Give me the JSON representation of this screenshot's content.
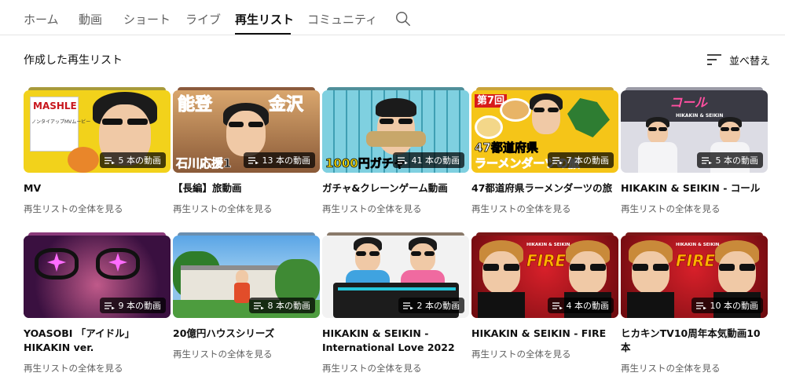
{
  "tabs": [
    {
      "label": "ホーム",
      "active": false
    },
    {
      "label": "動画",
      "active": false
    },
    {
      "label": "ショート",
      "active": false
    },
    {
      "label": "ライブ",
      "active": false
    },
    {
      "label": "再生リスト",
      "active": true
    },
    {
      "label": "コミュニティ",
      "active": false
    }
  ],
  "search": {
    "icon": "search-icon"
  },
  "section": {
    "title": "作成した再生リスト",
    "sort_label": "並べ替え",
    "sort_icon": "sort-icon"
  },
  "playlist_icon": "playlist-icon",
  "playlists": [
    {
      "title": "MV",
      "count": "5 本の動画",
      "link": "再生リストの全体を見る",
      "thumb_text": [
        "MASHLE",
        "ノンタイアップMVムービー"
      ]
    },
    {
      "title": "【長編】旅動画",
      "count": "13 本の動画",
      "link": "再生リストの全体を見る",
      "thumb_text": [
        "能登",
        "金沢",
        "石川応援1"
      ]
    },
    {
      "title": "ガチャ&クレーンゲーム動画",
      "count": "41 本の動画",
      "link": "再生リストの全体を見る",
      "thumb_text": [
        "1000円ガチャ"
      ]
    },
    {
      "title": "47都道府県ラーメンダーツの旅",
      "count": "7 本の動画",
      "link": "再生リストの全体を見る",
      "thumb_text": [
        "第7回",
        "47都道府県",
        "ラーメンダーツの旅"
      ]
    },
    {
      "title": "HIKAKIN & SEIKIN - コール",
      "count": "5 本の動画",
      "link": "再生リストの全体を見る",
      "thumb_text": [
        "コール",
        "HIKAKIN & SEIKIN"
      ]
    },
    {
      "title": "YOASOBI 「アイドル」 HIKAKIN ver.",
      "count": "9 本の動画",
      "link": "再生リストの全体を見る",
      "thumb_text": []
    },
    {
      "title": "20億円ハウスシリーズ",
      "count": "8 本の動画",
      "link": "再生リストの全体を見る",
      "thumb_text": []
    },
    {
      "title": "HIKAKIN & SEIKIN - International Love 2022",
      "count": "2 本の動画",
      "link": "再生リストの全体を見る",
      "thumb_text": []
    },
    {
      "title": "HIKAKIN & SEIKIN - FIRE",
      "count": "4 本の動画",
      "link": "再生リストの全体を見る",
      "thumb_text": [
        "HIKAKIN & SEIKIN",
        "FIRE"
      ]
    },
    {
      "title": "ヒカキンTV10周年本気動画10本",
      "count": "10 本の動画",
      "link": "再生リストの全体を見る",
      "thumb_text": [
        "HIKAKIN & SEIKIN",
        "FIRE"
      ]
    }
  ],
  "colors": {
    "text_primary": "#0f0f0f",
    "text_secondary": "#606060",
    "divider": "#e5e5e5",
    "badge_bg": "rgba(0,0,0,0.72)"
  }
}
